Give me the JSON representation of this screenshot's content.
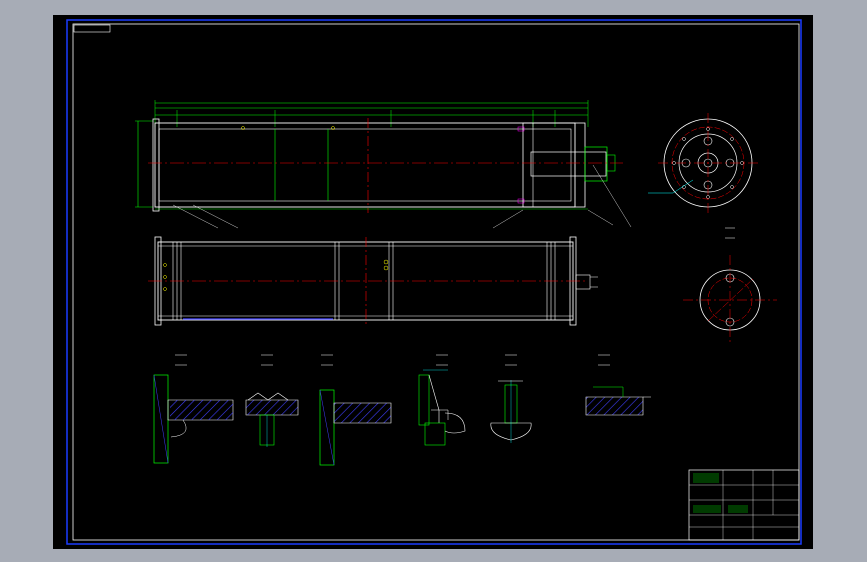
{
  "drawing": {
    "corner_label": "",
    "title_block_label": "",
    "title_block_code": "",
    "note_heading": "",
    "note_lines": [
      "",
      "",
      ""
    ]
  },
  "colors": {
    "background_outer": "#a7acb6",
    "sheet": "#000000",
    "border": "#0000ff",
    "frame_line": "#ffffff",
    "part_line": "#ffffff",
    "dimension": "#00ff00",
    "centerline": "#ff0000",
    "hatch": "#4040ff",
    "leader": "#00ffff",
    "accent": "#ff00ff"
  },
  "views": [
    {
      "name": "front-section-view"
    },
    {
      "name": "top-view"
    },
    {
      "name": "flange-end-view"
    },
    {
      "name": "hole-end-view"
    },
    {
      "name": "detail-section-views"
    },
    {
      "name": "title-block"
    }
  ]
}
